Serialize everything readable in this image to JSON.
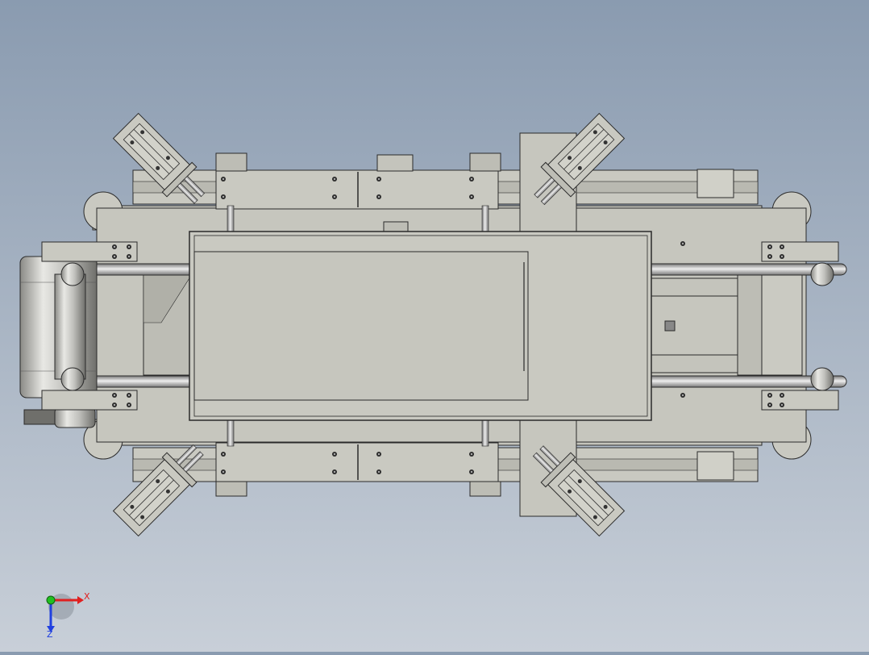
{
  "viewport": {
    "background_top": "#8a9bb0",
    "background_bottom": "#c8cfd8",
    "part_fill": "#c9c9c1",
    "part_shade": "#b4b4ab",
    "edge_color": "#2a2a2a"
  },
  "model": {
    "description_icon": "cad-assembly-top-view"
  },
  "triad": {
    "x_label": "X",
    "z_label": "Z",
    "x_color": "#e02020",
    "y_color": "#20c020",
    "z_color": "#2040e0"
  }
}
